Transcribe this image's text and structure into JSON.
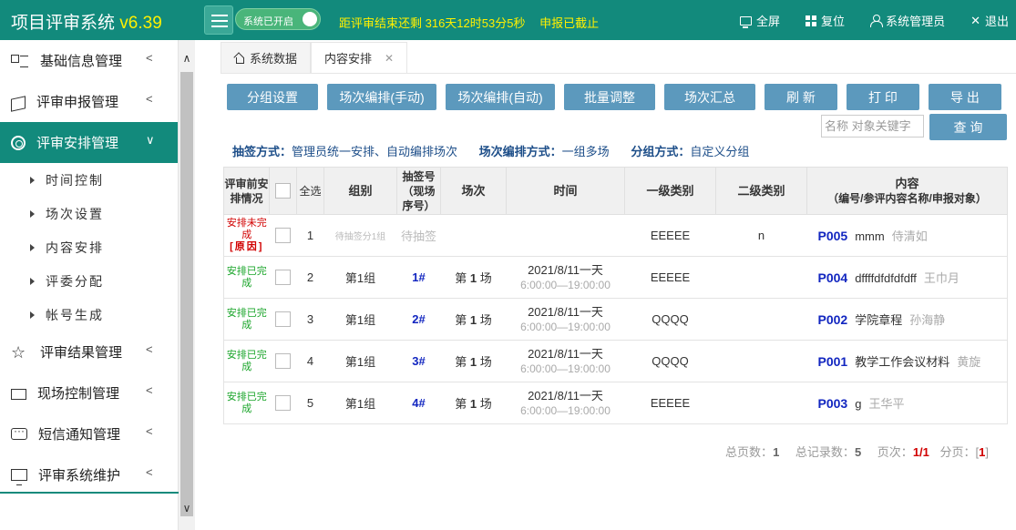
{
  "header": {
    "title": "项目评审系统",
    "version": "v6.39",
    "toggle_label": "系统已开启",
    "countdown": "距评审结束还剩 316天12时53分5秒",
    "status": "申报已截止",
    "actions": {
      "fullscreen": "全屏",
      "reset": "复位",
      "user": "系统管理员",
      "logout": "退出"
    }
  },
  "sidebar": {
    "items": [
      {
        "label": "基础信息管理",
        "icon": "list-icon"
      },
      {
        "label": "评审申报管理",
        "icon": "cube-icon"
      },
      {
        "label": "评审安排管理",
        "icon": "gear-icon"
      },
      {
        "label": "评审结果管理",
        "icon": "star-icon"
      },
      {
        "label": "现场控制管理",
        "icon": "monitor-icon"
      },
      {
        "label": "短信通知管理",
        "icon": "sms-icon"
      },
      {
        "label": "评审系统维护",
        "icon": "computer-icon"
      }
    ],
    "sub_items": [
      "时间控制",
      "场次设置",
      "内容安排",
      "评委分配",
      "帐号生成"
    ]
  },
  "tabs": [
    {
      "label": "系统数据"
    },
    {
      "label": "内容安排"
    }
  ],
  "toolbar": {
    "buttons": [
      "分组设置",
      "场次编排(手动)",
      "场次编排(自动)",
      "批量调整",
      "场次汇总",
      "刷 新",
      "打 印",
      "导 出"
    ],
    "search_placeholder": "名称 对象关键字",
    "query_label": "查 询"
  },
  "modes": {
    "draw_label": "抽签方式：",
    "draw_value": "管理员统一安排、自动编排场次",
    "session_label": "场次编排方式：",
    "session_value": "一组多场",
    "group_label": "分组方式：",
    "group_value": "自定义分组"
  },
  "table": {
    "headers": {
      "status": "评审前安排情况",
      "select_all": "全选",
      "group": "组别",
      "draw_no": "抽签号（现场序号）",
      "session": "场次",
      "time": "时间",
      "cat1": "一级类别",
      "cat2": "二级类别",
      "content": "内容",
      "content_sub": "（编号/参评内容名称/申报对象）"
    },
    "rows": [
      {
        "status": "安排未完成",
        "reason": "[原因]",
        "ok": false,
        "index": "1",
        "group": "待抽签分1组",
        "draw": "待抽签",
        "session_pre": "",
        "session_num": "",
        "session_post": "",
        "date": "",
        "time": "",
        "cat1": "EEEEE",
        "cat2": "n",
        "code": "P005",
        "name": "mmm",
        "who": "侍清如"
      },
      {
        "status": "安排已完成",
        "reason": "",
        "ok": true,
        "index": "2",
        "group": "第1组",
        "draw": "1#",
        "session_pre": "第 ",
        "session_num": "1",
        "session_post": " 场",
        "date": "2021/8/11一天",
        "time": "6:00:00—19:00:00",
        "cat1": "EEEEE",
        "cat2": "",
        "code": "P004",
        "name": "dffffdfdfdfdff",
        "who": "王巾月"
      },
      {
        "status": "安排已完成",
        "reason": "",
        "ok": true,
        "index": "3",
        "group": "第1组",
        "draw": "2#",
        "session_pre": "第 ",
        "session_num": "1",
        "session_post": " 场",
        "date": "2021/8/11一天",
        "time": "6:00:00—19:00:00",
        "cat1": "QQQQ",
        "cat2": "",
        "code": "P002",
        "name": "学院章程",
        "who": "孙海静"
      },
      {
        "status": "安排已完成",
        "reason": "",
        "ok": true,
        "index": "4",
        "group": "第1组",
        "draw": "3#",
        "session_pre": "第 ",
        "session_num": "1",
        "session_post": " 场",
        "date": "2021/8/11一天",
        "time": "6:00:00—19:00:00",
        "cat1": "QQQQ",
        "cat2": "",
        "code": "P001",
        "name": "教学工作会议材料",
        "who": "黄旋"
      },
      {
        "status": "安排已完成",
        "reason": "",
        "ok": true,
        "index": "5",
        "group": "第1组",
        "draw": "4#",
        "session_pre": "第 ",
        "session_num": "1",
        "session_post": " 场",
        "date": "2021/8/11一天",
        "time": "6:00:00—19:00:00",
        "cat1": "EEEEE",
        "cat2": "",
        "code": "P003",
        "name": "g",
        "who": "王华平"
      }
    ]
  },
  "pager": {
    "total_pages_label": "总页数：",
    "total_pages": "1",
    "total_records_label": "总记录数：",
    "total_records": "5",
    "page_label": "页次：",
    "page_value": "1/1",
    "paging_label": "分页：[",
    "paging_num": "1",
    "paging_end": "]"
  },
  "colors": {
    "brand": "#128a7c",
    "button": "#5c99bd",
    "highlight": "#fff000",
    "ok": "#1aa52a",
    "bad": "#d10000",
    "code": "#1226c0"
  }
}
